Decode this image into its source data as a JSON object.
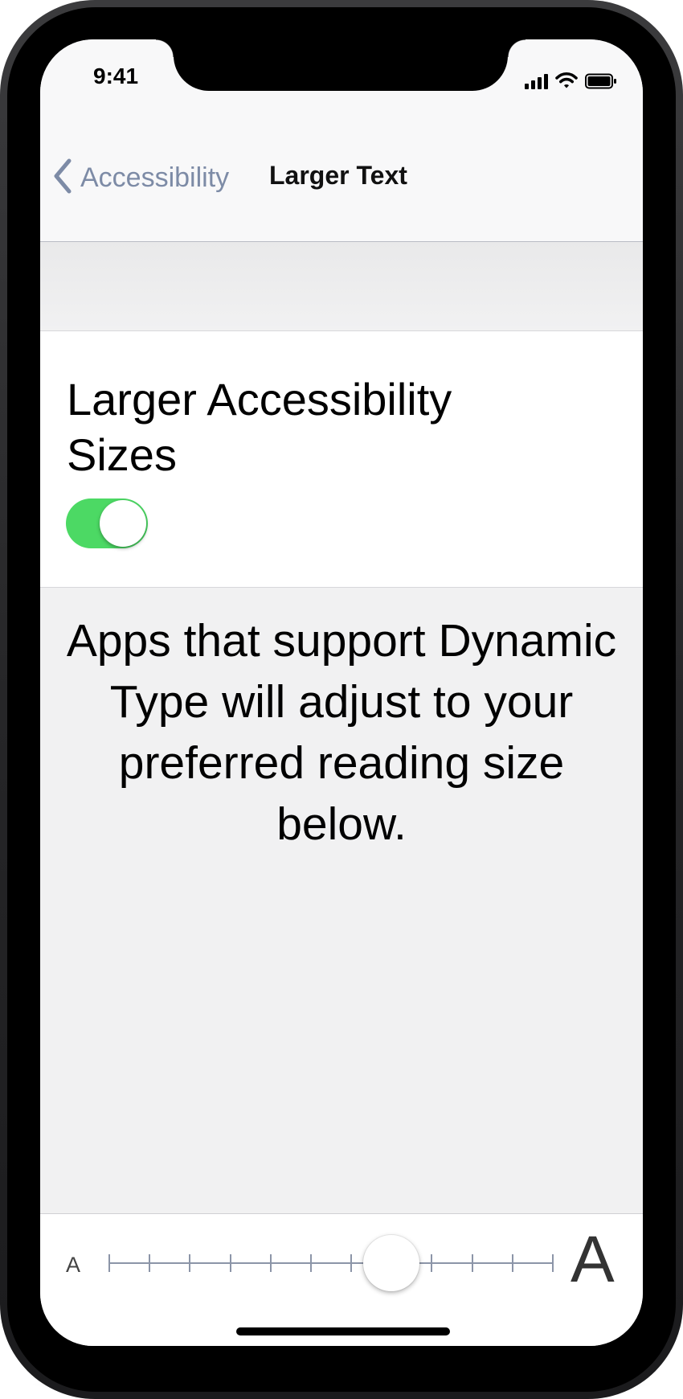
{
  "status_bar": {
    "time": "9:41",
    "icons": [
      "signal-icon",
      "wifi-icon",
      "battery-icon"
    ]
  },
  "nav": {
    "back_label": "Accessibility",
    "back_icon": "chevron-left-icon",
    "title": "Larger Text"
  },
  "toggle": {
    "label": "Larger Accessibility Sizes",
    "on": true,
    "on_color": "#4cd964"
  },
  "info": {
    "text": "Apps that support Dynamic Type will adjust to your preferred reading size below."
  },
  "slider": {
    "min_label": "A",
    "max_label": "A",
    "steps": 12,
    "value_index": 7,
    "track_color": "#8c95a8"
  }
}
